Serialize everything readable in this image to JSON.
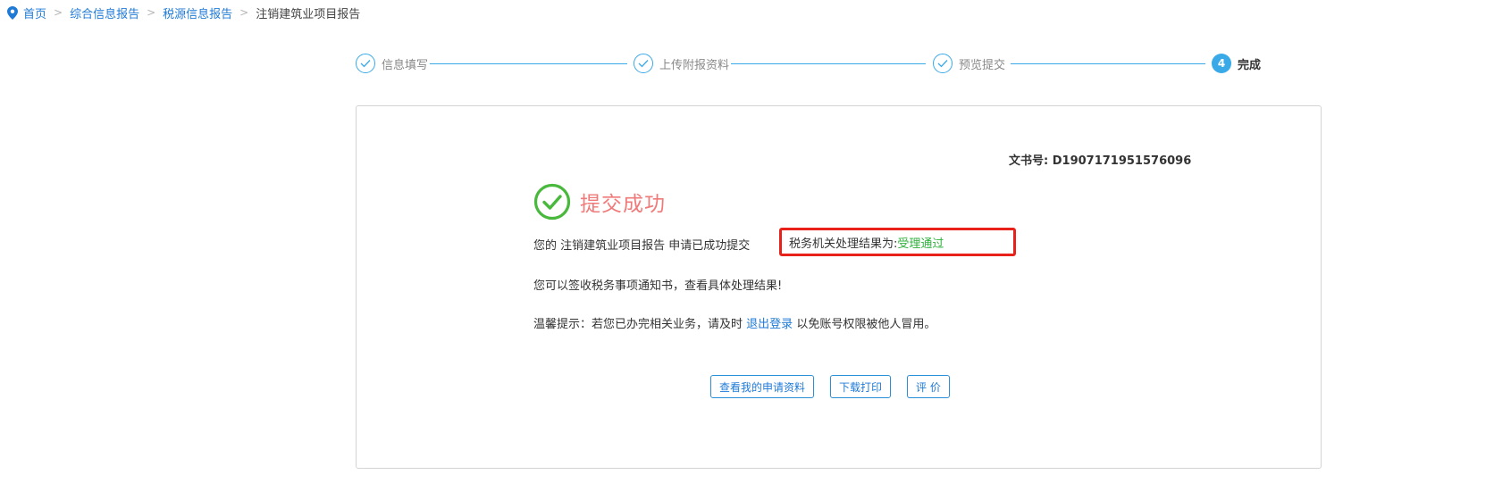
{
  "breadcrumb": {
    "items": [
      "首页",
      "综合信息报告",
      "税源信息报告"
    ],
    "current": "注销建筑业项目报告",
    "separator": ">"
  },
  "steps": [
    {
      "label": "信息填写",
      "status": "done"
    },
    {
      "label": "上传附报资料",
      "status": "done"
    },
    {
      "label": "预览提交",
      "status": "done"
    },
    {
      "label": "完成",
      "number": "4",
      "status": "active"
    }
  ],
  "result": {
    "doc_no_label": "文书号:",
    "doc_no": "D1907171951576096",
    "title": "提交成功",
    "line1_prefix": "您的 注销建筑业项目报告 申请已成功提交",
    "line1_result_label": "税务机关处理结果为:",
    "line1_result_value": "受理通过",
    "line2": "您可以签收税务事项通知书，查看具体处理结果!",
    "line3_prefix": "温馨提示：若您已办完相关业务，请及时",
    "line3_link": "退出登录",
    "line3_suffix": "以免账号权限被他人冒用。"
  },
  "buttons": {
    "view": "查看我的申请资料",
    "download": "下载打印",
    "rate": "评 价"
  },
  "colors": {
    "accent": "#39a9e8",
    "link": "#1f7ad6",
    "success_title": "#f07a7a",
    "success_icon": "#49b93d",
    "result_ok": "#2fb13b",
    "highlight_border": "#e8211a"
  }
}
